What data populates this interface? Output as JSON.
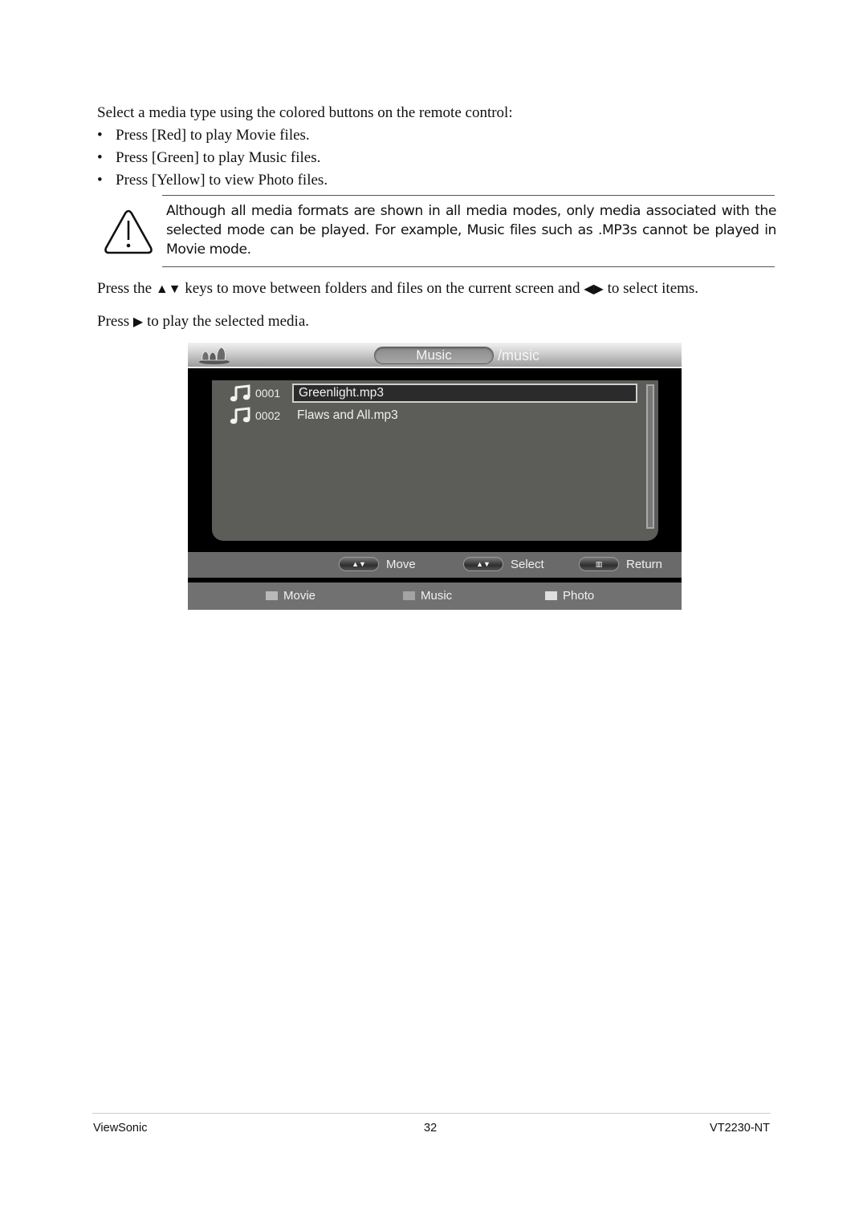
{
  "intro": {
    "lead": "Select a media type using the colored buttons on the remote control:",
    "bullet_char": "•",
    "bullets": [
      "Press [Red] to play Movie files.",
      "Press [Green] to play Music files.",
      "Press [Yellow] to view Photo files."
    ]
  },
  "note": {
    "icon": "warning-icon",
    "text": "Although all media formats are shown in all media modes, only media associated with the selected mode can be played. For example, Music files such as .MP3s cannot be played in Movie mode."
  },
  "instructions": {
    "para1_a": "Press the ",
    "para1_updown": "▲▼",
    "para1_b": " keys to move between folders and files on the current screen and ",
    "para1_leftright": "◀▶",
    "para1_c": " to select items.",
    "para2_a": "Press ",
    "para2_play": "▶",
    "para2_b": " to play the selected media."
  },
  "tv": {
    "header": {
      "mode_label": "Music",
      "path": "/music"
    },
    "files": [
      {
        "index": "0001",
        "name": "Greenlight.mp3",
        "selected": true,
        "icon": "music-note-icon"
      },
      {
        "index": "0002",
        "name": "Flaws  and All.mp3",
        "selected": false,
        "icon": "music-note-icon"
      }
    ],
    "help": [
      {
        "key_icon": "up-down-arrows-icon",
        "key_glyph": "▲▼",
        "label": "Move"
      },
      {
        "key_icon": "up-down-arrows-icon",
        "key_glyph": "▲▼",
        "label": "Select"
      },
      {
        "key_icon": "menu-icon",
        "key_glyph": "▥",
        "label": "Return"
      }
    ],
    "modes": [
      {
        "label": "Movie",
        "color": "#b9b9b9"
      },
      {
        "label": "Music",
        "color": "#a3a3a3"
      },
      {
        "label": "Photo",
        "color": "#dedede"
      }
    ]
  },
  "footer": {
    "brand": "ViewSonic",
    "page": "32",
    "model": "VT2230-NT"
  }
}
